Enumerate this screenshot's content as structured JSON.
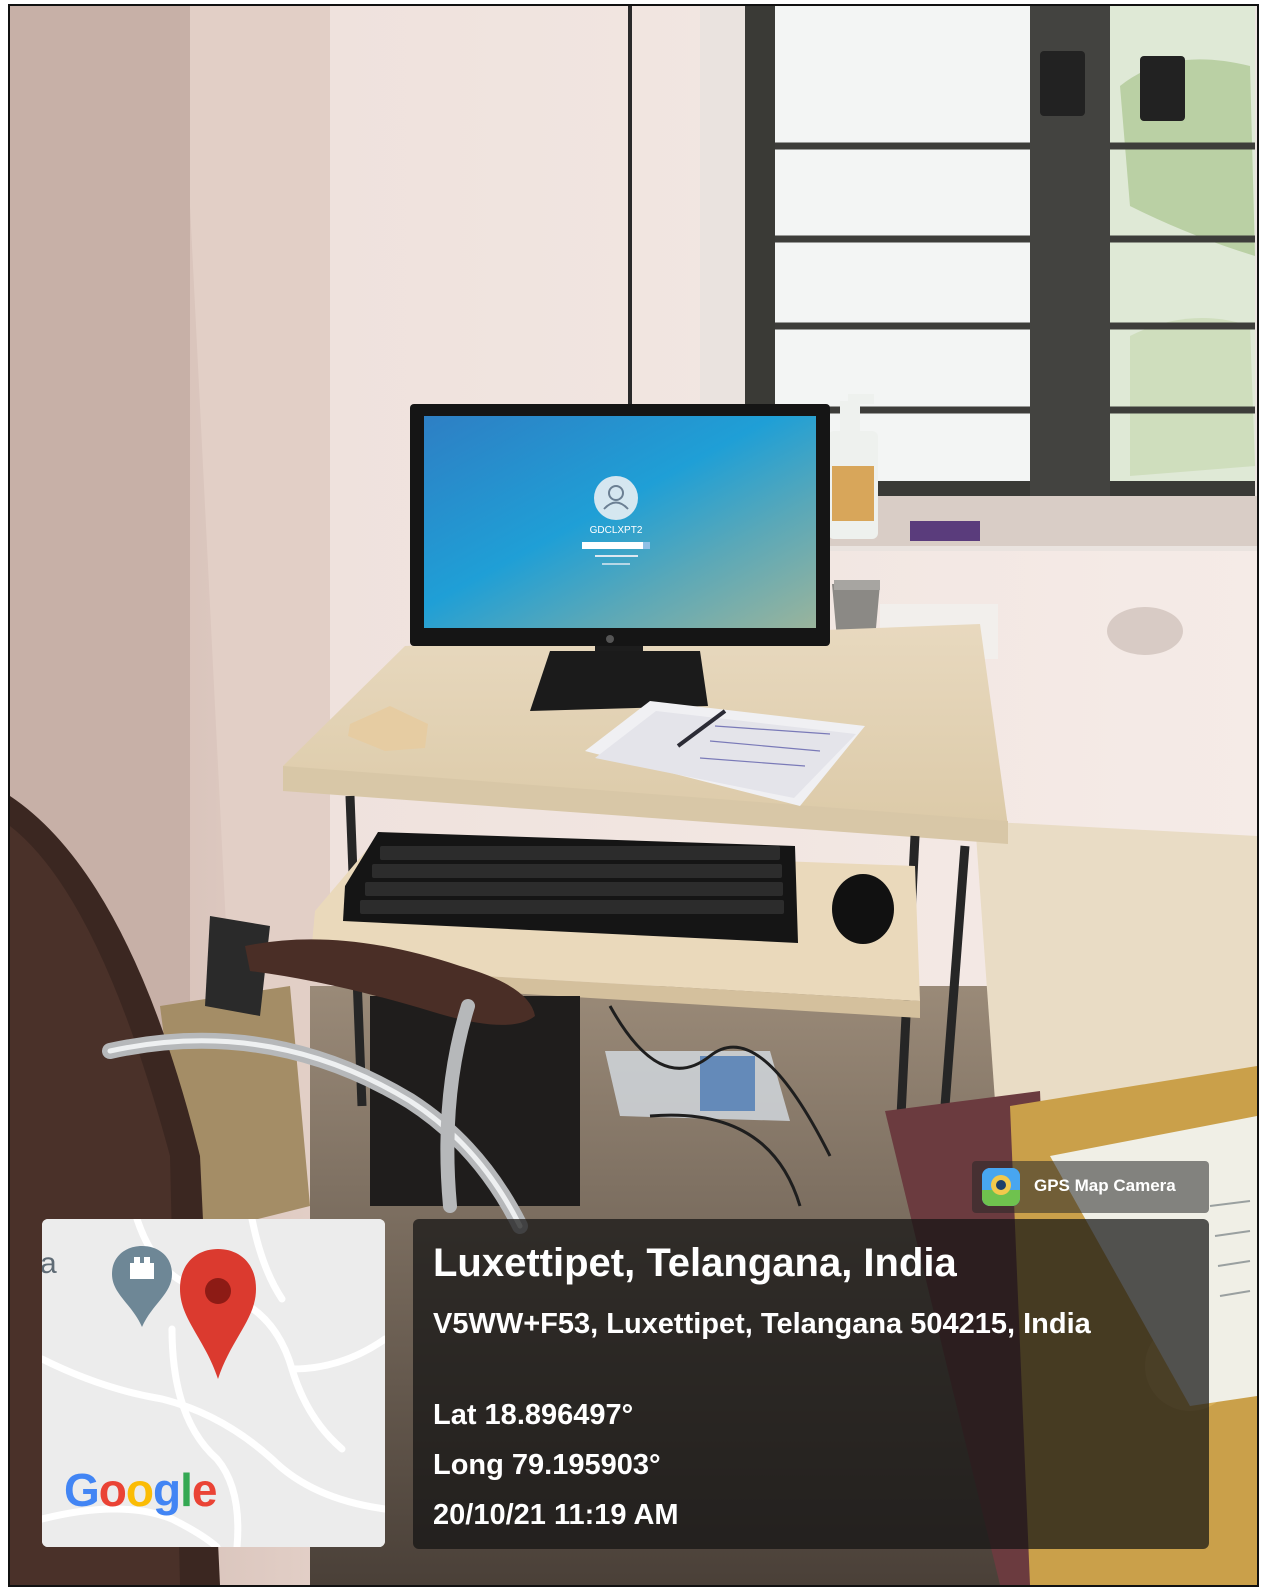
{
  "overlay": {
    "app_badge": "GPS Map Camera",
    "map_logo": [
      "G",
      "o",
      "o",
      "g",
      "l",
      "e"
    ],
    "map_logo_colors": [
      "#4285F4",
      "#EA4335",
      "#FBBC05",
      "#4285F4",
      "#34A853",
      "#EA4335"
    ],
    "title": "Luxettipet, Telangana, India",
    "address": "V5WW+F53, Luxettipet, Telangana 504215, India",
    "lat": "Lat 18.896497°",
    "long": "Long 79.195903°",
    "datetime": "20/10/21 11:19 AM",
    "map_label_fragment": "a"
  },
  "scene": {
    "monitor_username": "GDCLXPT2"
  },
  "colors": {
    "pin_red": "#db3a2f",
    "pin_dark": "#8d1b15",
    "poi_gray": "#6e8796"
  }
}
